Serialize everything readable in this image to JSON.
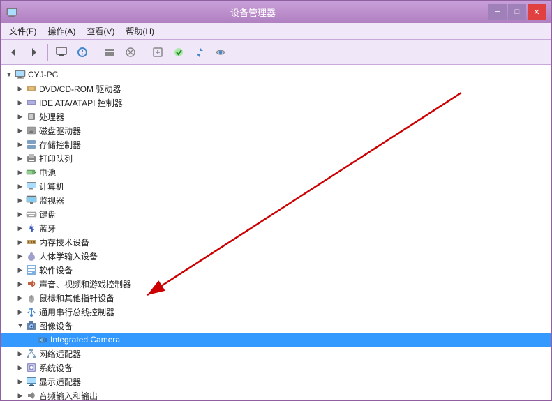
{
  "window": {
    "title": "设备管理器",
    "title_icon": "💻"
  },
  "controls": {
    "minimize": "─",
    "maximize": "□",
    "close": "✕"
  },
  "menu": {
    "items": [
      {
        "label": "文件(F)"
      },
      {
        "label": "操作(A)"
      },
      {
        "label": "查看(V)"
      },
      {
        "label": "帮助(H)"
      }
    ]
  },
  "tree": {
    "root": {
      "label": "CYJ-PC",
      "expanded": true
    },
    "items": [
      {
        "depth": 1,
        "label": "DVD/CD-ROM 驱动器",
        "icon": "dvd",
        "expanded": false
      },
      {
        "depth": 1,
        "label": "IDE ATA/ATAPI 控制器",
        "icon": "ide",
        "expanded": false
      },
      {
        "depth": 1,
        "label": "处理器",
        "icon": "cpu",
        "expanded": false
      },
      {
        "depth": 1,
        "label": "磁盘驱动器",
        "icon": "disk",
        "expanded": false
      },
      {
        "depth": 1,
        "label": "存储控制器",
        "icon": "storage",
        "expanded": false
      },
      {
        "depth": 1,
        "label": "打印队列",
        "icon": "print",
        "expanded": false
      },
      {
        "depth": 1,
        "label": "电池",
        "icon": "battery",
        "expanded": false
      },
      {
        "depth": 1,
        "label": "计算机",
        "icon": "computer",
        "expanded": false
      },
      {
        "depth": 1,
        "label": "监视器",
        "icon": "monitor",
        "expanded": false
      },
      {
        "depth": 1,
        "label": "键盘",
        "icon": "keyboard",
        "expanded": false
      },
      {
        "depth": 1,
        "label": "蓝牙",
        "icon": "bluetooth",
        "expanded": false
      },
      {
        "depth": 1,
        "label": "内存技术设备",
        "icon": "memory",
        "expanded": false
      },
      {
        "depth": 1,
        "label": "人体学输入设备",
        "icon": "hid",
        "expanded": false
      },
      {
        "depth": 1,
        "label": "软件设备",
        "icon": "software",
        "expanded": false
      },
      {
        "depth": 1,
        "label": "声音、视频和游戏控制器",
        "icon": "sound",
        "expanded": false
      },
      {
        "depth": 1,
        "label": "鼠标和其他指针设备",
        "icon": "mouse",
        "expanded": false
      },
      {
        "depth": 1,
        "label": "通用串行总线控制器",
        "icon": "usb",
        "expanded": false
      },
      {
        "depth": 1,
        "label": "图像设备",
        "icon": "camera_group",
        "expanded": true
      },
      {
        "depth": 2,
        "label": "Integrated Camera",
        "icon": "camera",
        "expanded": false,
        "selected": true
      },
      {
        "depth": 1,
        "label": "网络适配器",
        "icon": "network",
        "expanded": false
      },
      {
        "depth": 1,
        "label": "系统设备",
        "icon": "system",
        "expanded": false
      },
      {
        "depth": 1,
        "label": "显示适配器",
        "icon": "display",
        "expanded": false
      },
      {
        "depth": 1,
        "label": "音频输入和输出",
        "icon": "audio",
        "expanded": false
      }
    ]
  }
}
